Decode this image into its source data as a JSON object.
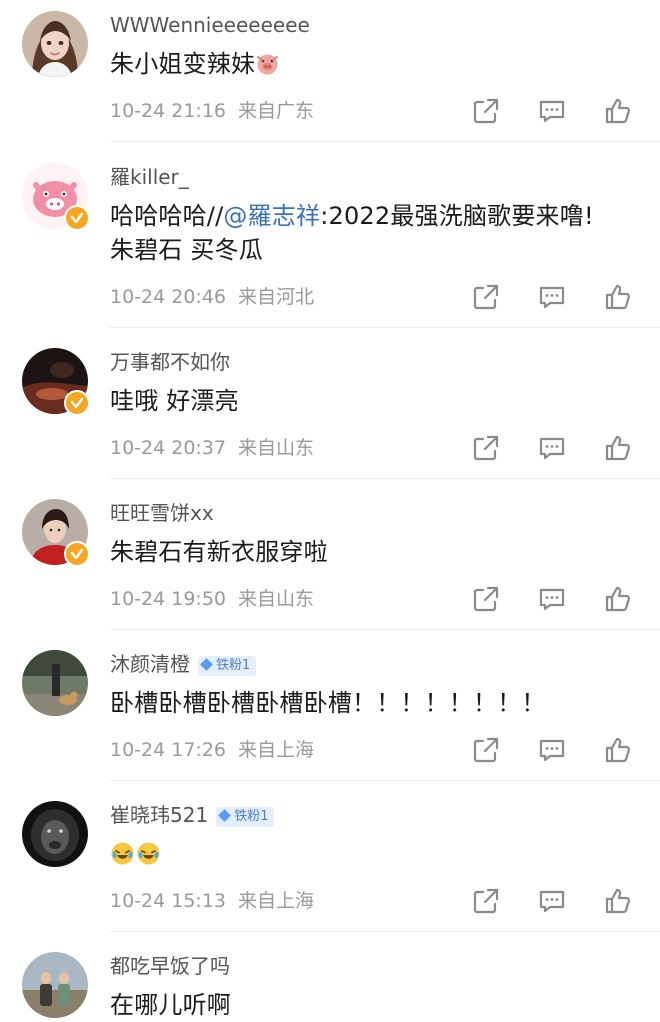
{
  "comments": [
    {
      "username": "WWWennieeeeeeee",
      "text": "朱小姐变辣妹",
      "date": "10-24 21:16",
      "location": "来自广东",
      "avatar_icon": "girl-avatar-icon",
      "verified": false,
      "emoji": "pig-emoji"
    },
    {
      "username": "羅killer_",
      "text_prefix": "哈哈哈哈//",
      "mention": "@羅志祥",
      "text_suffix": ":2022最强洗脑歌要来噜!",
      "text_line2": "朱碧石 买冬瓜",
      "date": "10-24 20:46",
      "location": "来自河北",
      "avatar_icon": "pink-pig-avatar-icon",
      "verified": true
    },
    {
      "username": "万事都不如你",
      "text": "哇哦 好漂亮",
      "date": "10-24 20:37",
      "location": "来自山东",
      "avatar_icon": "dark-photo-avatar-icon",
      "verified": true
    },
    {
      "username": "旺旺雪饼xx",
      "text": "朱碧石有新衣服穿啦",
      "date": "10-24 19:50",
      "location": "来自山东",
      "avatar_icon": "person-red-avatar-icon",
      "verified": true
    },
    {
      "username": "沐颜清橙",
      "badge": "铁粉1",
      "text": "卧槽卧槽卧槽卧槽卧槽！！！！！！！！",
      "date": "10-24 17:26",
      "location": "来自上海",
      "avatar_icon": "dog-street-avatar-icon",
      "verified": false
    },
    {
      "username": "崔晓玮521",
      "badge": "铁粉1",
      "text": "",
      "date": "10-24 15:13",
      "location": "来自上海",
      "avatar_icon": "lion-avatar-icon",
      "verified": false,
      "emoji": "crying-laughing-emoji"
    },
    {
      "username": "都吃早饭了吗",
      "text": "在哪儿听啊",
      "avatar_icon": "couple-photo-avatar-icon",
      "verified": false
    }
  ],
  "actions": {
    "share_icon": "share-icon",
    "comment_icon": "comment-icon",
    "like_icon": "like-icon"
  },
  "colors": {
    "mention": "#3b71b8",
    "verified": "#f5a623",
    "meta": "#9a9a9a",
    "badge_text": "#4c7ed6"
  }
}
